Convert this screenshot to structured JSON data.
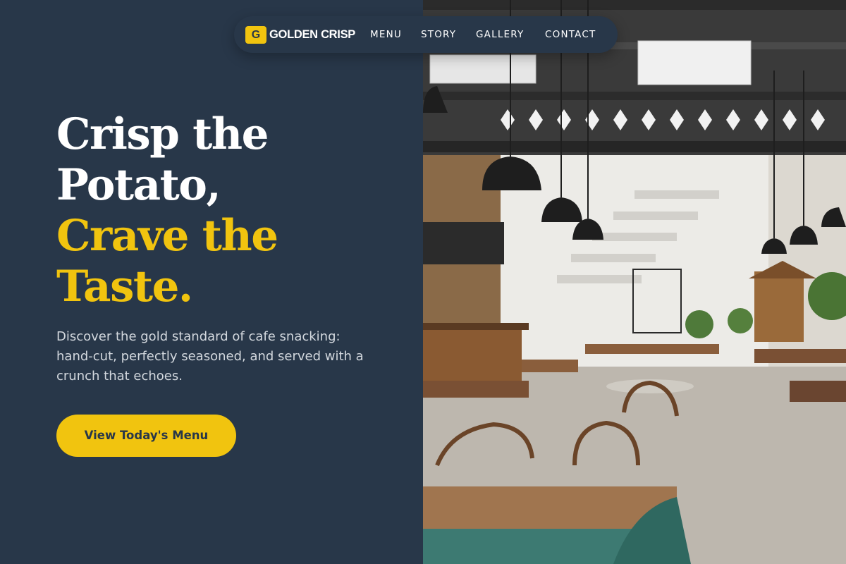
{
  "brand": {
    "badge_letter": "G",
    "name": "GOLDEN CRISP"
  },
  "nav": {
    "links": [
      "MENU",
      "STORY",
      "GALLERY",
      "CONTACT"
    ]
  },
  "hero": {
    "headline_lines": [
      "Crisp the",
      "Potato,",
      "Crave the",
      "Taste."
    ],
    "subtitle": "Discover the gold standard of cafe snacking: hand-cut, perfectly seasoned, and served with a crunch that echoes.",
    "cta_label": "View Today's Menu",
    "image_subject": "cafe-interior-photo"
  },
  "colors": {
    "background": "#283749",
    "accent": "#f1c40f",
    "text_primary": "#ffffff",
    "text_muted": "#d3d8de"
  }
}
